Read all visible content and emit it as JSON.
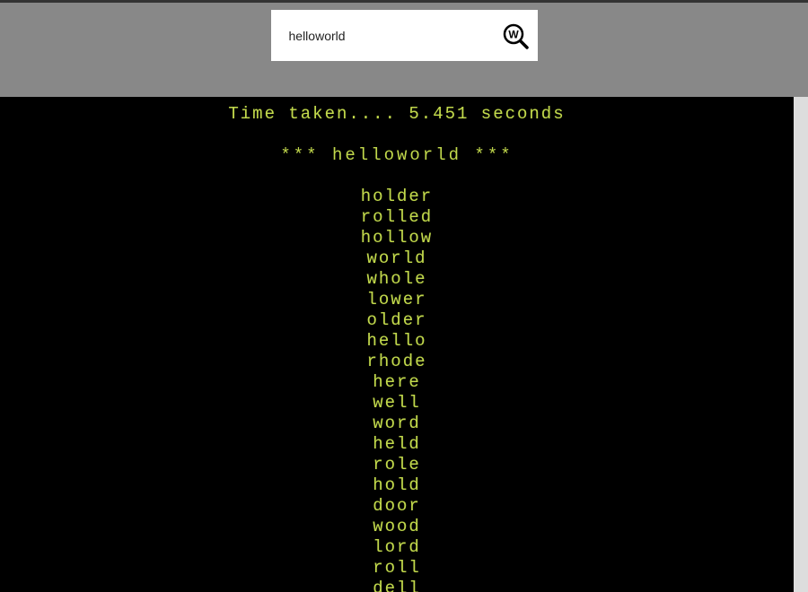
{
  "search": {
    "value": "helloworld"
  },
  "terminal": {
    "time_line": "Time taken.... 5.451 seconds",
    "title_prefix": "*** ",
    "title_word": "helloworld",
    "title_suffix": " ***",
    "words": [
      "holder",
      "rolled",
      "hollow",
      "world",
      "whole",
      "lower",
      "older",
      "hello",
      "rhode",
      "here",
      "well",
      "word",
      "held",
      "role",
      "hold",
      "door",
      "wood",
      "lord",
      "roll",
      "dell"
    ]
  },
  "colors": {
    "term_green": "#c2d94c",
    "bg_gray": "#888"
  }
}
